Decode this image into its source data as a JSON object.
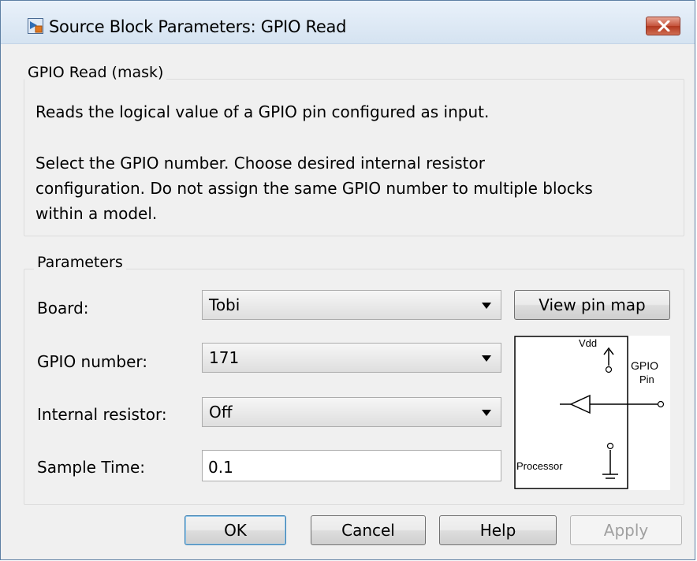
{
  "window": {
    "title": "Source Block Parameters: GPIO Read",
    "icons": {
      "app": "simulink-block-icon",
      "close": "close-icon"
    }
  },
  "description": {
    "legend": "GPIO Read (mask)",
    "line1": "Reads the logical value of a GPIO pin configured as input.",
    "line2": "Select the GPIO number. Choose desired internal resistor",
    "line3": "configuration. Do not assign the same GPIO number to multiple blocks",
    "line4": "within a model."
  },
  "parameters": {
    "legend": "Parameters",
    "board": {
      "label": "Board:",
      "value": "Tobi"
    },
    "view_pin_map": "View pin map",
    "gpio_number": {
      "label": "GPIO number:",
      "value": "171"
    },
    "internal_resistor": {
      "label": "Internal resistor:",
      "value": "Off"
    },
    "sample_time": {
      "label": "Sample Time:",
      "value": "0.1"
    }
  },
  "diagram": {
    "vdd": "Vdd",
    "gpio": "GPIO",
    "pin": "Pin",
    "processor": "Processor"
  },
  "buttons": {
    "ok": "OK",
    "cancel": "Cancel",
    "help": "Help",
    "apply": "Apply"
  },
  "colors": {
    "titlebar": "#dce8f5",
    "close_button": "#c5533c",
    "dialog_bg": "#f0f0f0",
    "ok_focus_border": "#3c7fb1"
  }
}
